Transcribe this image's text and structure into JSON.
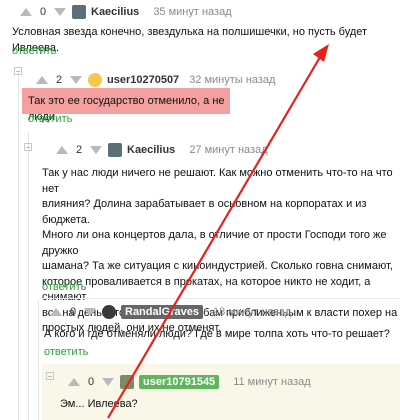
{
  "comments": [
    {
      "score": "0",
      "user": "Kaecilius",
      "time": "35 минут назад",
      "text": "Условная звезда конечно, звездулька на полшишечки, но пусть будет Ивлеева.",
      "reply": "ответить"
    },
    {
      "score": "2",
      "user": "user10270507",
      "time": "32 минуты назад",
      "text": "Так это ее государство отменило, а не люди",
      "reply": "ответить"
    },
    {
      "score": "2",
      "user": "Kaecilius",
      "time": "27 минут назад",
      "lines": [
        "Так у нас люди ничего не решают. Как можно отменить что-то на что нет",
        "влияния? Долина зарабатывает в основном на корпоратах и из бюджета.",
        "Много ли она концертов дала, в отличие от прости Господи того же дружко",
        "шамана? Та же ситуация с киноиндустрией. Сколько говна снимают,",
        "которое проваливается в прокатах, на которое никто не ходит, а снимают",
        "все на деньги государства. Особам приближенным к власти похер на",
        "простых людей, они их не отменят."
      ],
      "reply": "ответить"
    },
    {
      "score": "0",
      "user": "RandalGraves",
      "time": "18 минут назад",
      "text": "А кого и где отменяли люди? Где в мире толпа хоть что-то решает?",
      "reply": "ответить"
    },
    {
      "score": "0",
      "user": "user10791545",
      "time": "11 минут назад",
      "text": "Эм... Ивлеева?"
    }
  ],
  "colors": {
    "reply": "#2f9c3a",
    "highlight": "#f4a0a0",
    "annotation": "#e8221b"
  },
  "icons": [
    "arrow-up-icon",
    "arrow-down-icon",
    "collapse-icon",
    "avatar-icon"
  ]
}
